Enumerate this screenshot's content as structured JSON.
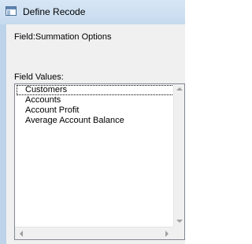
{
  "window": {
    "title": "Define Recode",
    "icon": "window-app-icon"
  },
  "field": {
    "label": "Field:",
    "value": "Summation Options"
  },
  "field_values": {
    "label": "Field Values:",
    "items": [
      "Customers",
      "Accounts",
      "Account Profit",
      "Average Account Balance"
    ],
    "focused_index": 0
  },
  "colors": {
    "titlebar": "#c6daee",
    "client_background": "#f0f0f0",
    "list_background": "#ffffff"
  }
}
